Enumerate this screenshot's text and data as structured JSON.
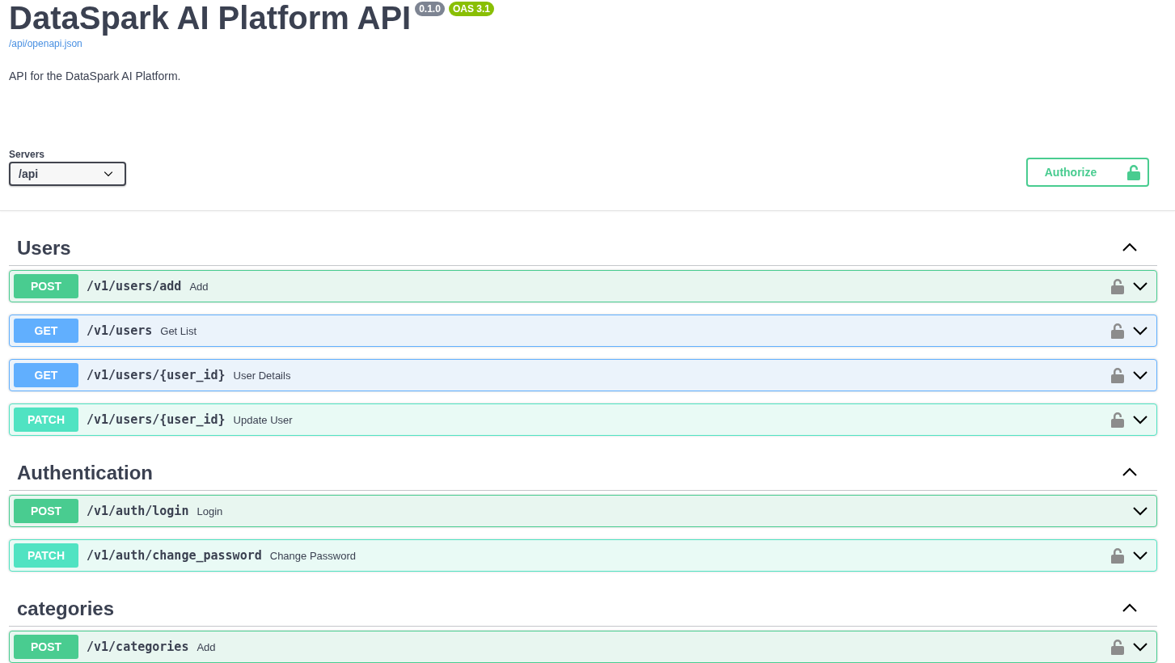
{
  "info": {
    "title": "DataSpark AI Platform API",
    "version": "0.1.0",
    "oas": "OAS 3.1",
    "spec_link": "/api/openapi.json",
    "description": "API for the DataSpark AI Platform."
  },
  "servers": {
    "label": "Servers",
    "value": "/api"
  },
  "authorize": {
    "label": "Authorize"
  },
  "sections": [
    {
      "name": "Users",
      "expanded": true,
      "operations": [
        {
          "kind": "post",
          "method": "POST",
          "path": "/v1/users/add",
          "summary": "Add",
          "locked": true
        },
        {
          "kind": "get",
          "method": "GET",
          "path": "/v1/users",
          "summary": "Get List",
          "locked": true
        },
        {
          "kind": "get",
          "method": "GET",
          "path": "/v1/users/{user_id}",
          "summary": "User Details",
          "locked": true
        },
        {
          "kind": "patch",
          "method": "PATCH",
          "path": "/v1/users/{user_id}",
          "summary": "Update User",
          "locked": true
        }
      ]
    },
    {
      "name": "Authentication",
      "expanded": true,
      "operations": [
        {
          "kind": "post",
          "method": "POST",
          "path": "/v1/auth/login",
          "summary": "Login",
          "locked": false
        },
        {
          "kind": "patch",
          "method": "PATCH",
          "path": "/v1/auth/change_password",
          "summary": "Change Password",
          "locked": true
        }
      ]
    },
    {
      "name": "categories",
      "expanded": true,
      "operations": [
        {
          "kind": "post",
          "method": "POST",
          "path": "/v1/categories",
          "summary": "Add",
          "locked": true
        }
      ]
    }
  ]
}
